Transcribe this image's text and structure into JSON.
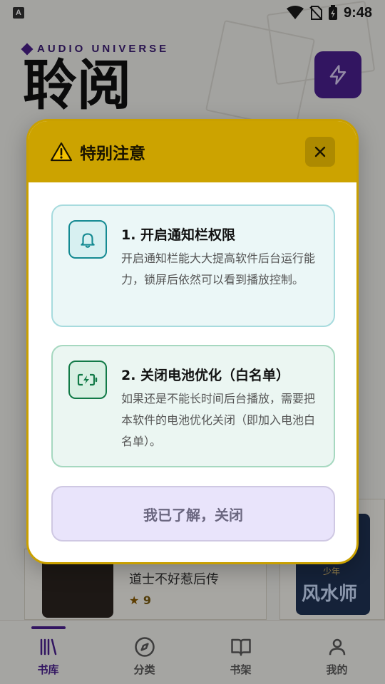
{
  "status_bar": {
    "app_badge": "A",
    "time": "9:48"
  },
  "brand": {
    "subtitle": "AUDIO UNIVERSE",
    "title": "聆阅"
  },
  "background": {
    "book_title": "道士不好惹后传",
    "book_rating": "9",
    "cover_text_right": "风水师",
    "cover_badge_right": "少年"
  },
  "dialog": {
    "title": "特别注意",
    "items": [
      {
        "title": "1. 开启通知栏权限",
        "body": "开启通知栏能大大提高软件后台运行能力，锁屏后依然可以看到播放控制。"
      },
      {
        "title": "2. 关闭电池优化（白名单）",
        "body": "如果还是不能长时间后台播放，需要把本软件的电池优化关闭（即加入电池白名单）。"
      }
    ],
    "confirm_label": "我已了解，关闭"
  },
  "bottom_nav": {
    "items": [
      {
        "label": "书库",
        "active": true
      },
      {
        "label": "分类",
        "active": false
      },
      {
        "label": "书架",
        "active": false
      },
      {
        "label": "我的",
        "active": false
      }
    ]
  },
  "colors": {
    "accent": "#4a1f8f",
    "dialog_header": "#cca300",
    "notice_teal": "#148a92",
    "notice_green": "#117a47",
    "confirm_bg": "#e9e4fb"
  }
}
